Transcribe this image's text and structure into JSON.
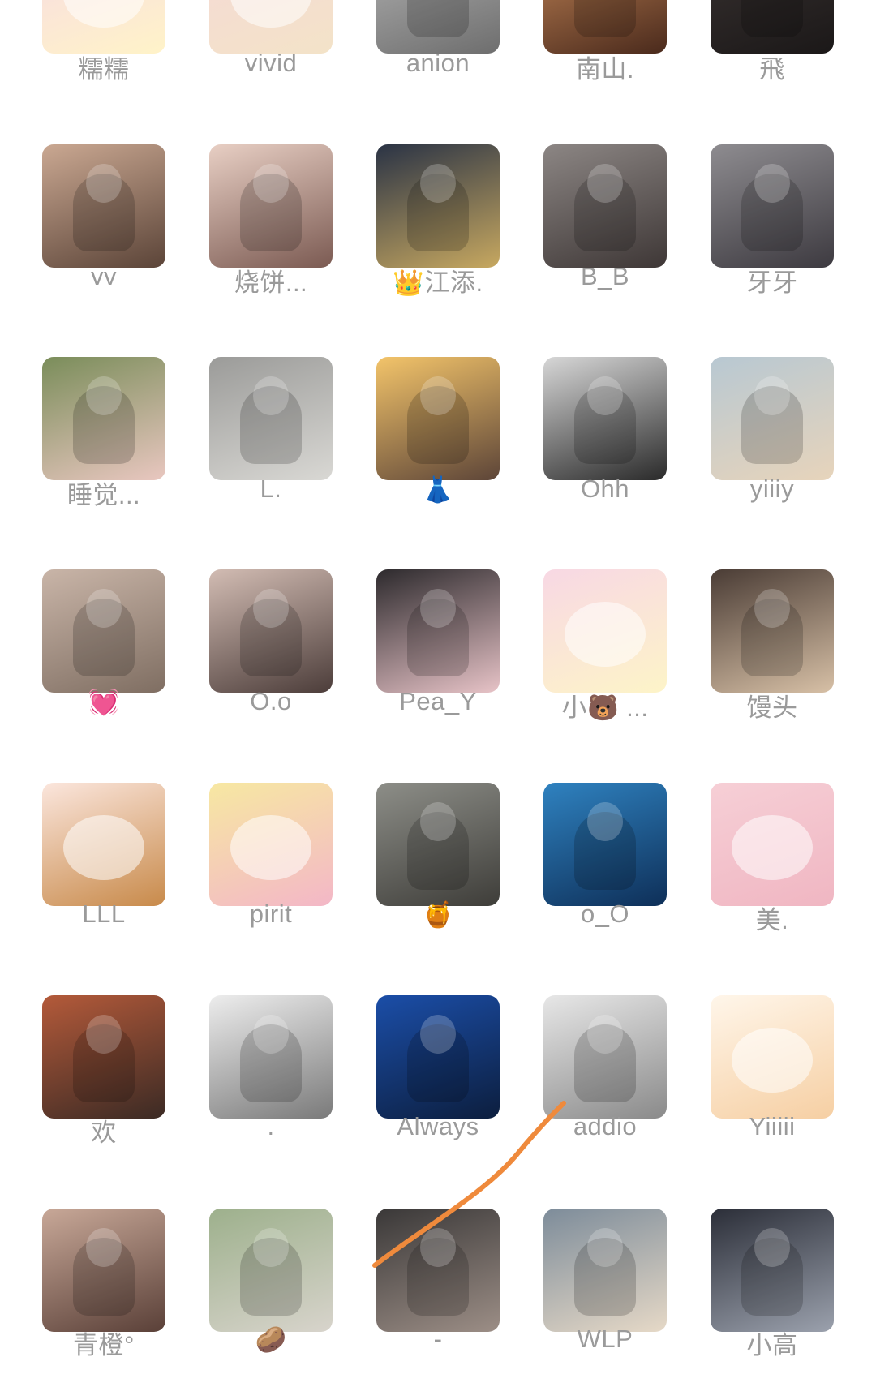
{
  "contacts": [
    {
      "name": "糯糯",
      "colors": [
        "#f7d9e6",
        "#fff3c8"
      ],
      "cartoon": true
    },
    {
      "name": "vivid",
      "colors": [
        "#f6d8d8",
        "#f3e3c8"
      ],
      "cartoon": true
    },
    {
      "name": "anion",
      "colors": [
        "#b8b8b8",
        "#6e6e6e"
      ],
      "cartoon": false
    },
    {
      "name": "南山.",
      "colors": [
        "#c98a5a",
        "#4a2a1c"
      ],
      "cartoon": false
    },
    {
      "name": "飛",
      "colors": [
        "#3b3433",
        "#1b1818"
      ],
      "cartoon": false
    },
    {
      "name": "vv",
      "colors": [
        "#caa892",
        "#5b4438"
      ],
      "cartoon": false
    },
    {
      "name": "烧饼...",
      "colors": [
        "#e8cfc4",
        "#7b5a52"
      ],
      "cartoon": false
    },
    {
      "name": "👑江添.",
      "colors": [
        "#2a3345",
        "#c7a860"
      ],
      "cartoon": false
    },
    {
      "name": "B_B",
      "colors": [
        "#8c8684",
        "#3e3736"
      ],
      "cartoon": false
    },
    {
      "name": "牙牙",
      "colors": [
        "#8e8c90",
        "#3d3a40"
      ],
      "cartoon": false
    },
    {
      "name": "睡觉...",
      "colors": [
        "#7a8d5a",
        "#e9c7c0"
      ],
      "cartoon": false
    },
    {
      "name": "L.",
      "colors": [
        "#9b9b99",
        "#d9d8d4"
      ],
      "cartoon": false
    },
    {
      "name": "👗",
      "colors": [
        "#f3c46a",
        "#5d4538"
      ],
      "cartoon": false
    },
    {
      "name": "Ohh",
      "colors": [
        "#d7d7d7",
        "#2a2a2a"
      ],
      "cartoon": false
    },
    {
      "name": "yiiiy",
      "colors": [
        "#b8c8d2",
        "#e7d4bb"
      ],
      "cartoon": false
    },
    {
      "name": "💓",
      "colors": [
        "#c9b5a8",
        "#7f6e62"
      ],
      "cartoon": false
    },
    {
      "name": "O.o",
      "colors": [
        "#d2bcb3",
        "#4c3d3a"
      ],
      "cartoon": false
    },
    {
      "name": "Pea_Y",
      "colors": [
        "#2d2a2d",
        "#e7c3c7"
      ],
      "cartoon": false
    },
    {
      "name": "小🐻 ...",
      "colors": [
        "#f8d8e4",
        "#fdf4c8"
      ],
      "cartoon": true
    },
    {
      "name": "馒头",
      "colors": [
        "#4a3c35",
        "#d7c0a6"
      ],
      "cartoon": false
    },
    {
      "name": "LLL",
      "colors": [
        "#fbe6dd",
        "#c88a4a"
      ],
      "cartoon": true
    },
    {
      "name": "pirit",
      "colors": [
        "#f7e8a2",
        "#f3b7c7"
      ],
      "cartoon": true
    },
    {
      "name": "🍯",
      "colors": [
        "#8d8e88",
        "#3e3d39"
      ],
      "cartoon": false
    },
    {
      "name": "o_O",
      "colors": [
        "#2f82c0",
        "#0e2f58"
      ],
      "cartoon": false
    },
    {
      "name": "美.",
      "colors": [
        "#f6cfd6",
        "#f0b6c2"
      ],
      "cartoon": true
    },
    {
      "name": "欢",
      "colors": [
        "#b45a3a",
        "#3b2a24"
      ],
      "cartoon": false
    },
    {
      "name": ".",
      "colors": [
        "#ededed",
        "#7a7a7a"
      ],
      "cartoon": false
    },
    {
      "name": "Always",
      "colors": [
        "#1b4ea8",
        "#0c1e3e"
      ],
      "cartoon": false
    },
    {
      "name": "addio",
      "colors": [
        "#e7e7e7",
        "#8a8a8a"
      ],
      "cartoon": false
    },
    {
      "name": "Yiiiii",
      "colors": [
        "#fff6ea",
        "#f6cfa3"
      ],
      "cartoon": true
    },
    {
      "name": "青橙°",
      "colors": [
        "#c8a898",
        "#5a4038"
      ],
      "cartoon": false
    },
    {
      "name": "🥔",
      "colors": [
        "#9db08c",
        "#d8d4cc"
      ],
      "cartoon": false
    },
    {
      "name": "-",
      "colors": [
        "#3a3838",
        "#9c8e86"
      ],
      "cartoon": false
    },
    {
      "name": "WLP",
      "colors": [
        "#7d8c9a",
        "#e6d9c7"
      ],
      "cartoon": false
    },
    {
      "name": "小高",
      "colors": [
        "#2b2e38",
        "#9ba1ad"
      ],
      "cartoon": false
    }
  ],
  "annotation": {
    "stroke_color": "#ef8a3c"
  }
}
